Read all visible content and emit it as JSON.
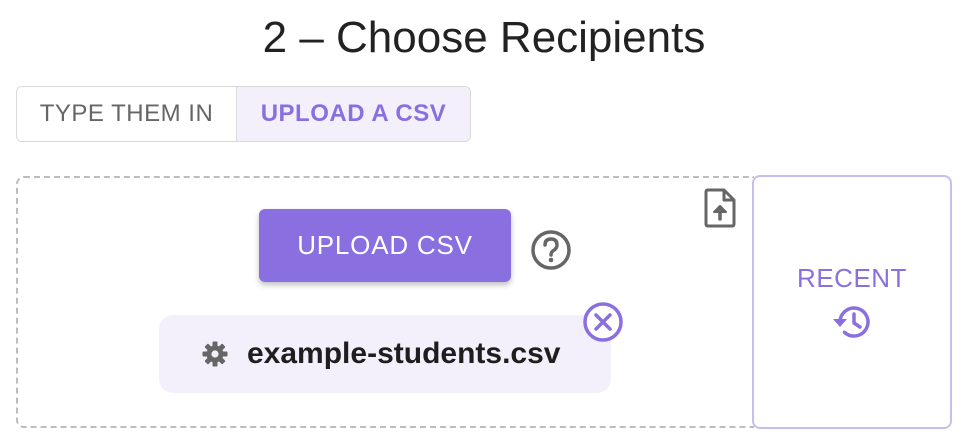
{
  "page": {
    "title": "2 – Choose Recipients"
  },
  "mode_toggle": {
    "options": [
      {
        "label": "TYPE THEM IN",
        "selected": false
      },
      {
        "label": "UPLOAD A CSV",
        "selected": true
      }
    ]
  },
  "upload": {
    "button_label": "UPLOAD CSV",
    "help_icon": "help-circle-icon",
    "file_upload_icon": "file-upload-icon"
  },
  "selected_file": {
    "name": "example-students.csv",
    "settings_icon": "gear-icon",
    "remove_icon": "close-circle-icon"
  },
  "recent": {
    "label": "RECENT",
    "icon": "history-icon"
  },
  "colors": {
    "accent": "#8a6fe0",
    "accent_light": "#f3f0fb",
    "title_text": "#222222",
    "muted_text": "#666666",
    "icon_gray": "#666666"
  }
}
